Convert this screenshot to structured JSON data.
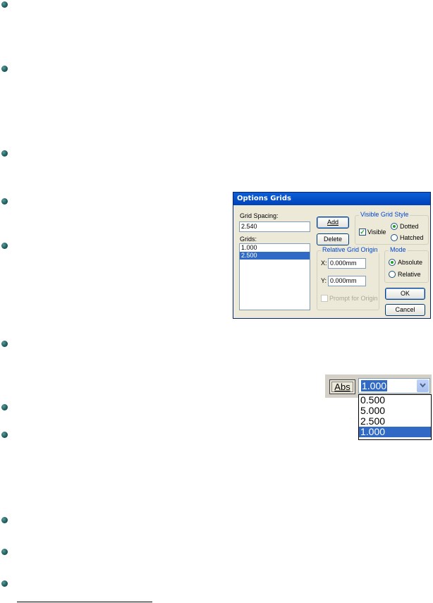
{
  "dialog": {
    "title": "Options Grids",
    "grid_spacing_label": "Grid Spacing:",
    "grid_spacing_value": "2.540",
    "grids_label": "Grids:",
    "grids": [
      "1.000",
      "2.500"
    ],
    "grids_selected_index": 1,
    "add_button": "Add",
    "delete_button": "Delete",
    "visible_grid_style": {
      "caption": "Visible Grid Style",
      "visible_label": "Visible",
      "visible_checked": true,
      "dotted_label": "Dotted",
      "hatched_label": "Hatched",
      "selected": "Dotted"
    },
    "relative_grid_origin": {
      "caption": "Relative Grid Origin",
      "x_label": "X:",
      "x_value": "0.000mm",
      "y_label": "Y:",
      "y_value": "0.000mm",
      "prompt_label": "Prompt for Origin",
      "prompt_enabled": false
    },
    "mode": {
      "caption": "Mode",
      "absolute_label": "Absolute",
      "relative_label": "Relative",
      "selected": "Absolute"
    },
    "ok_button": "OK",
    "cancel_button": "Cancel"
  },
  "grid_dropdown": {
    "abs_button": "Abs",
    "current_value": "1.000",
    "options": [
      "0.500",
      "5.000",
      "2.500",
      "1.000"
    ],
    "highlighted_index": 3
  },
  "colors": {
    "bullet": "#1f5f5f",
    "selection": "#316ac5",
    "title_bar": "#0a5fd8",
    "dialog_face": "#ece9d8"
  }
}
